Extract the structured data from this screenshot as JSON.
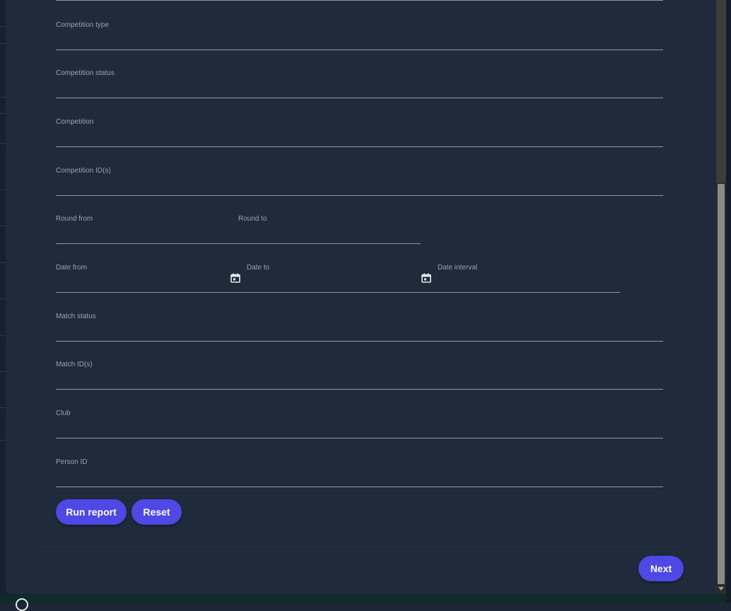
{
  "form": {
    "fields": {
      "competition_type": {
        "label": "Competition type",
        "value": ""
      },
      "competition_status": {
        "label": "Competition status",
        "value": ""
      },
      "competition": {
        "label": "Competition",
        "value": ""
      },
      "competition_ids": {
        "label": "Competition ID(s)",
        "value": ""
      },
      "round_from": {
        "label": "Round from",
        "value": ""
      },
      "round_to": {
        "label": "Round to",
        "value": ""
      },
      "date_from": {
        "label": "Date from",
        "value": ""
      },
      "date_to": {
        "label": "Date to",
        "value": ""
      },
      "date_interval": {
        "label": "Date interval",
        "value": ""
      },
      "match_status": {
        "label": "Match status",
        "value": ""
      },
      "match_ids": {
        "label": "Match ID(s)",
        "value": ""
      },
      "club": {
        "label": "Club",
        "value": ""
      },
      "person_id": {
        "label": "Person ID",
        "value": ""
      }
    },
    "actions": {
      "run_report": "Run report",
      "reset": "Reset"
    }
  },
  "footer": {
    "next": "Next"
  },
  "icons": {
    "calendar": "calendar-icon"
  },
  "colors": {
    "dialog_bg": "#1f2a3b",
    "accent": "#4e48e4",
    "label": "#9aa3ae",
    "underline": "#8e97a3"
  }
}
